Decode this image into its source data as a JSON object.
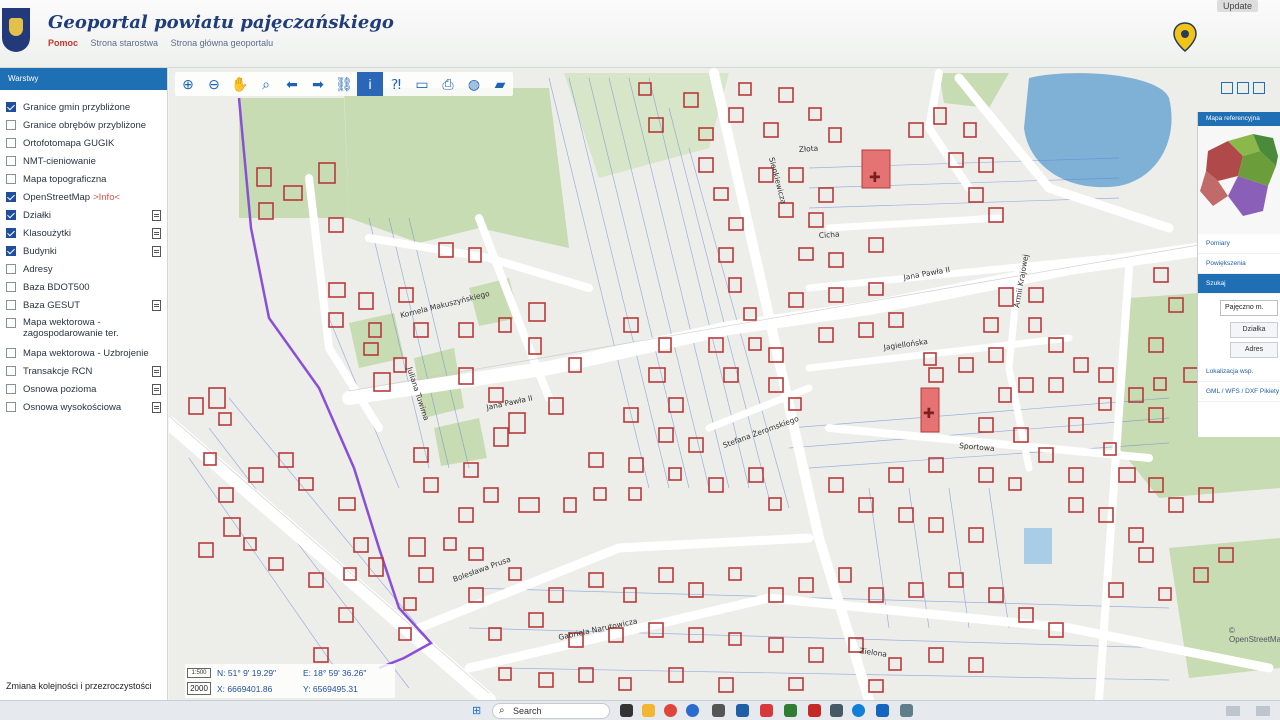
{
  "header": {
    "title": "Geoportal powiatu pajęczańskiego",
    "links": [
      "Pomoc",
      "Strona starostwa",
      "Strona główna geoportalu"
    ],
    "update_label": "Update"
  },
  "sidebar": {
    "title": "Warstwy",
    "layers": [
      {
        "label": "Granice gmin przybliżone",
        "checked": true,
        "info": "",
        "doc": false
      },
      {
        "label": "Granice obrębów przybliżone",
        "checked": false,
        "info": "",
        "doc": false
      },
      {
        "label": "Ortofotomapa GUGIK",
        "checked": false,
        "info": "",
        "doc": false
      },
      {
        "label": "NMT-cieniowanie",
        "checked": false,
        "info": "",
        "doc": false
      },
      {
        "label": "Mapa topograficzna",
        "checked": false,
        "info": "",
        "doc": false
      },
      {
        "label": "OpenStreetMap",
        "checked": true,
        "info": ">Info<",
        "doc": false
      },
      {
        "label": "Działki",
        "checked": true,
        "info": "",
        "doc": true
      },
      {
        "label": "Klasoużytki",
        "checked": true,
        "info": "",
        "doc": true
      },
      {
        "label": "Budynki",
        "checked": true,
        "info": "",
        "doc": true
      },
      {
        "label": "Adresy",
        "checked": false,
        "info": "",
        "doc": false
      },
      {
        "label": "Baza BDOT500",
        "checked": false,
        "info": "",
        "doc": false
      },
      {
        "label": "Baza GESUT",
        "checked": false,
        "info": "",
        "doc": true
      },
      {
        "label": "Mapa wektorowa - zagospodarowanie ter.",
        "checked": false,
        "info": "",
        "doc": false
      },
      {
        "label": "Mapa wektorowa - Uzbrojenie",
        "checked": false,
        "info": "",
        "doc": false
      },
      {
        "label": "Transakcje RCN",
        "checked": false,
        "info": "",
        "doc": true
      },
      {
        "label": "Osnowa pozioma",
        "checked": false,
        "info": "",
        "doc": true
      },
      {
        "label": "Osnowa wysokościowa",
        "checked": false,
        "info": "",
        "doc": true
      }
    ],
    "footer": "Zmiana kolejności i przezroczystości"
  },
  "toolbar": {
    "tools": [
      {
        "icon": "zoom-in-icon",
        "glyph": "⊕"
      },
      {
        "icon": "zoom-out-icon",
        "glyph": "⊖"
      },
      {
        "icon": "pan-hand-icon",
        "glyph": "✋"
      },
      {
        "icon": "zoom-extent-icon",
        "glyph": "⌕"
      },
      {
        "icon": "arrow-left-icon",
        "glyph": "⬅"
      },
      {
        "icon": "arrow-right-icon",
        "glyph": "➡"
      },
      {
        "icon": "link-icon",
        "glyph": "⛓"
      },
      {
        "icon": "info-icon",
        "glyph": "i",
        "active": true
      },
      {
        "icon": "query-icon",
        "glyph": "⁈"
      },
      {
        "icon": "measure-icon",
        "glyph": "▭"
      },
      {
        "icon": "print-icon",
        "glyph": "⎙"
      },
      {
        "icon": "globe-icon",
        "glyph": "◍"
      },
      {
        "icon": "camera-icon",
        "glyph": "▰"
      }
    ]
  },
  "right_panel": {
    "title": "Mapa referencyjna",
    "sections": [
      "Pomiary",
      "Powiększenia",
      "Szukaj"
    ],
    "search_value": "Pajęczno m.",
    "buttons": [
      "Działka",
      "Adres"
    ],
    "more_sections": [
      "Lokalizacja wsp.",
      "GML / WFS / DXF Pikiety"
    ]
  },
  "map": {
    "streets": [
      "Złota",
      "Cicha",
      "Jana Pawła II",
      "Jana Pawła II",
      "Jagiellońska",
      "Sportowa",
      "Stefana Żeromskiego",
      "Kornela Makuszyńskiego",
      "Bolesława Prusa",
      "Gabriela Narutowicza",
      "Zielona",
      "Juliana Tuwima",
      "Sienkiewicza",
      "Armii Krajowej"
    ],
    "osm_credit": "© OpenStreetMap"
  },
  "coords": {
    "scale": "1:500",
    "zoom": "2000",
    "n": "N: 51° 9' 19.29\"",
    "e": "E: 18° 59' 36.26\"",
    "x": "X: 6669401.86",
    "y": "Y: 6569495.31"
  },
  "taskbar": {
    "search": "Search"
  },
  "colors": {
    "accent": "#1f6fb5",
    "building": "#b83a3a",
    "green": "#c7dcb2",
    "water": "#7fb0d6",
    "road": "#ffffff"
  }
}
